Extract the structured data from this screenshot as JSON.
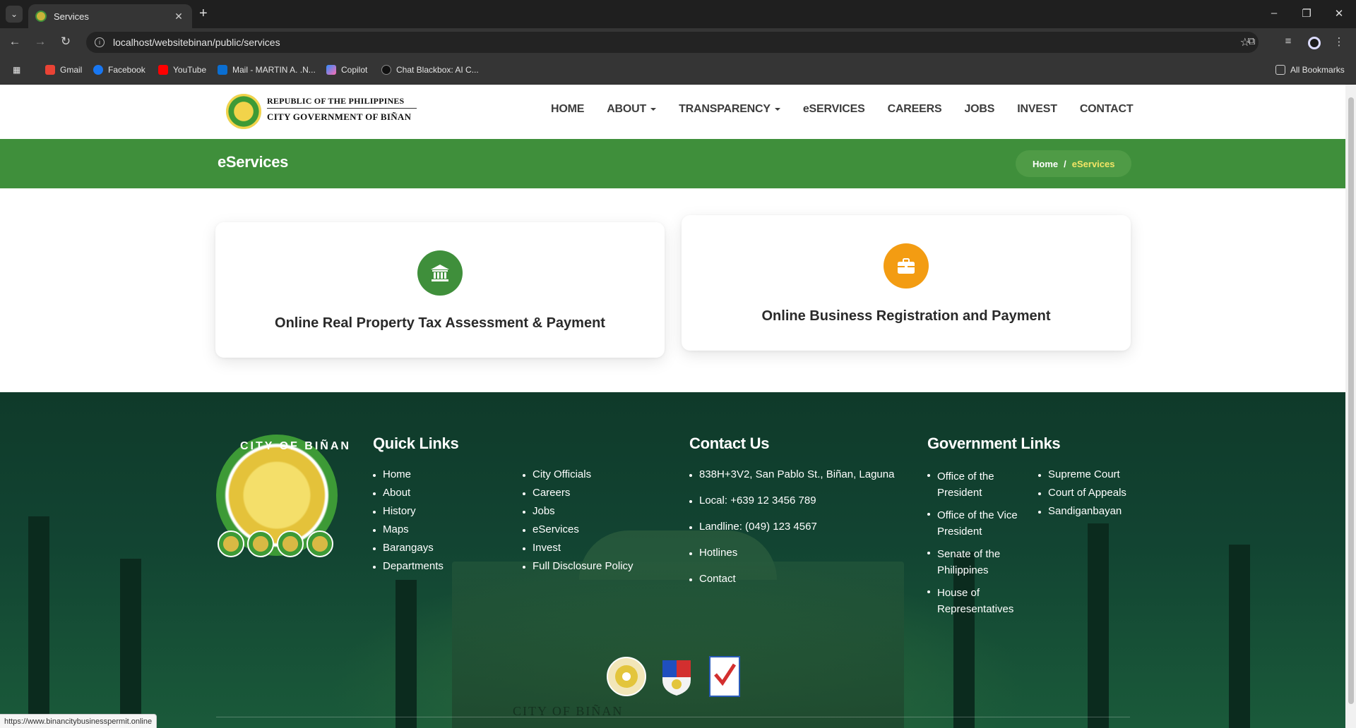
{
  "browser": {
    "tab_title": "Services",
    "url": "localhost/websitebinan/public/services",
    "bookmarks": [
      "Gmail",
      "Facebook",
      "YouTube",
      "Mail - MARTIN A. .N...",
      "Copilot",
      "Chat Blackbox: AI C..."
    ],
    "all_bookmarks": "All Bookmarks",
    "status_url": "https://www.binancitybusinesspermit.online"
  },
  "header": {
    "logo_line1": "REPUBLIC OF THE PHILIPPINES",
    "logo_line2": "CITY GOVERNMENT OF BIÑAN",
    "nav": [
      "HOME",
      "ABOUT",
      "TRANSPARENCY",
      "eSERVICES",
      "CAREERS",
      "JOBS",
      "INVEST",
      "CONTACT"
    ]
  },
  "banner": {
    "title": "eServices",
    "breadcrumb_home": "Home",
    "breadcrumb_sep": "/",
    "breadcrumb_current": "eServices"
  },
  "cards": [
    {
      "title": "Online Real Property Tax Assessment & Payment",
      "icon": "bank-icon",
      "color": "#3f8f3b"
    },
    {
      "title": "Online Business Registration and Payment",
      "icon": "briefcase-icon",
      "color": "#f39c12"
    }
  ],
  "footer": {
    "seal_text": "CITY OF BIÑAN",
    "city_name": "CITY OF BIÑAN",
    "quick_links_title": "Quick Links",
    "quick_links_col1": [
      "Home",
      "About",
      "History",
      "Maps",
      "Barangays",
      "Departments"
    ],
    "quick_links_col2": [
      "City Officials",
      "Careers",
      "Jobs",
      "eServices",
      "Invest",
      "Full Disclosure Policy"
    ],
    "contact_title": "Contact Us",
    "contact": [
      "838H+3V2, San Pablo St., Biñan, Laguna",
      "Local: +639 12 3456 789",
      "Landline: (049) 123 4567",
      "Hotlines",
      "Contact"
    ],
    "gov_title": "Government Links",
    "gov_col1": [
      "Office of the President",
      "Office of the Vice President",
      "Senate of the Philippines",
      "House of Representatives"
    ],
    "gov_col2": [
      "Supreme Court",
      "Court of Appeals",
      "Sandiganbayan"
    ]
  },
  "colors": {
    "green": "#3f8f3b",
    "orange": "#f39c12",
    "breadcrumb_current": "#f3e566"
  }
}
